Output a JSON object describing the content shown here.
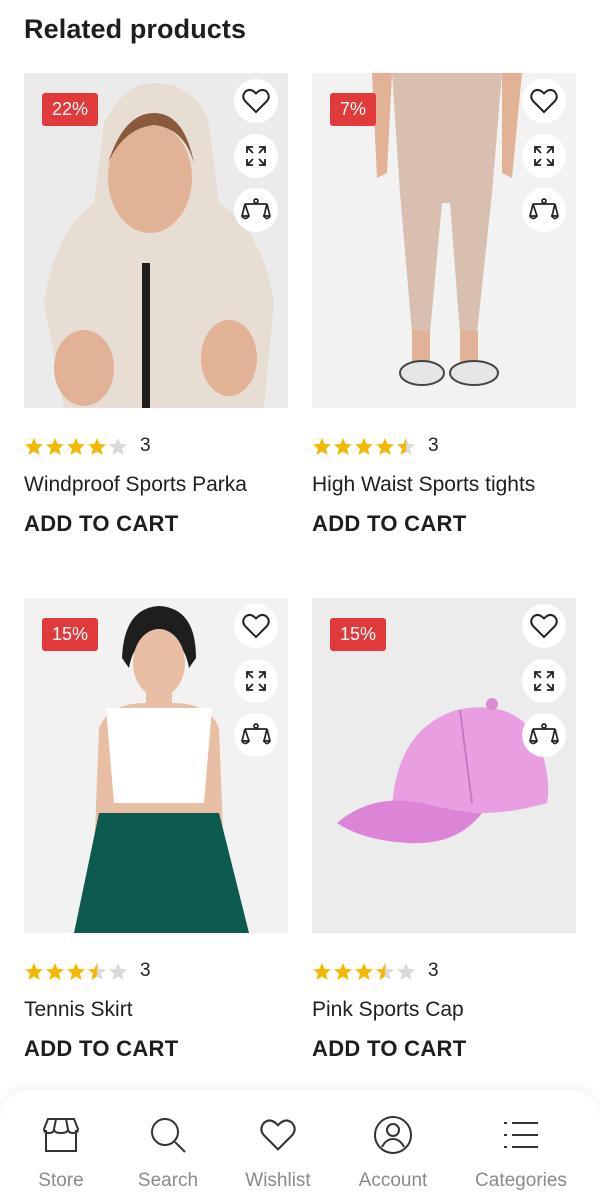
{
  "section": {
    "title": "Related products"
  },
  "products": [
    {
      "discount": "22%",
      "rating": 4,
      "rating_count": "3",
      "name": "Windproof Sports Parka",
      "cart_label": "ADD TO CART"
    },
    {
      "discount": "7%",
      "rating": 4.5,
      "rating_count": "3",
      "name": "High Waist Sports tights",
      "cart_label": "ADD TO CART"
    },
    {
      "discount": "15%",
      "rating": 3.5,
      "rating_count": "3",
      "name": "Tennis Skirt",
      "cart_label": "ADD TO CART"
    },
    {
      "discount": "15%",
      "rating": 3.5,
      "rating_count": "3",
      "name": "Pink Sports Cap",
      "cart_label": "ADD TO CART"
    }
  ],
  "bottom_nav": {
    "items": [
      {
        "label": "Store",
        "icon": "store-icon"
      },
      {
        "label": "Search",
        "icon": "search-icon"
      },
      {
        "label": "Wishlist",
        "icon": "heart-icon"
      },
      {
        "label": "Account",
        "icon": "account-icon"
      },
      {
        "label": "Categories",
        "icon": "menu-icon"
      }
    ]
  },
  "colors": {
    "badge": "#e03a3a",
    "star": "#f5b800",
    "star_empty": "#d9d9d9",
    "nav_label": "#8a8a8a"
  }
}
